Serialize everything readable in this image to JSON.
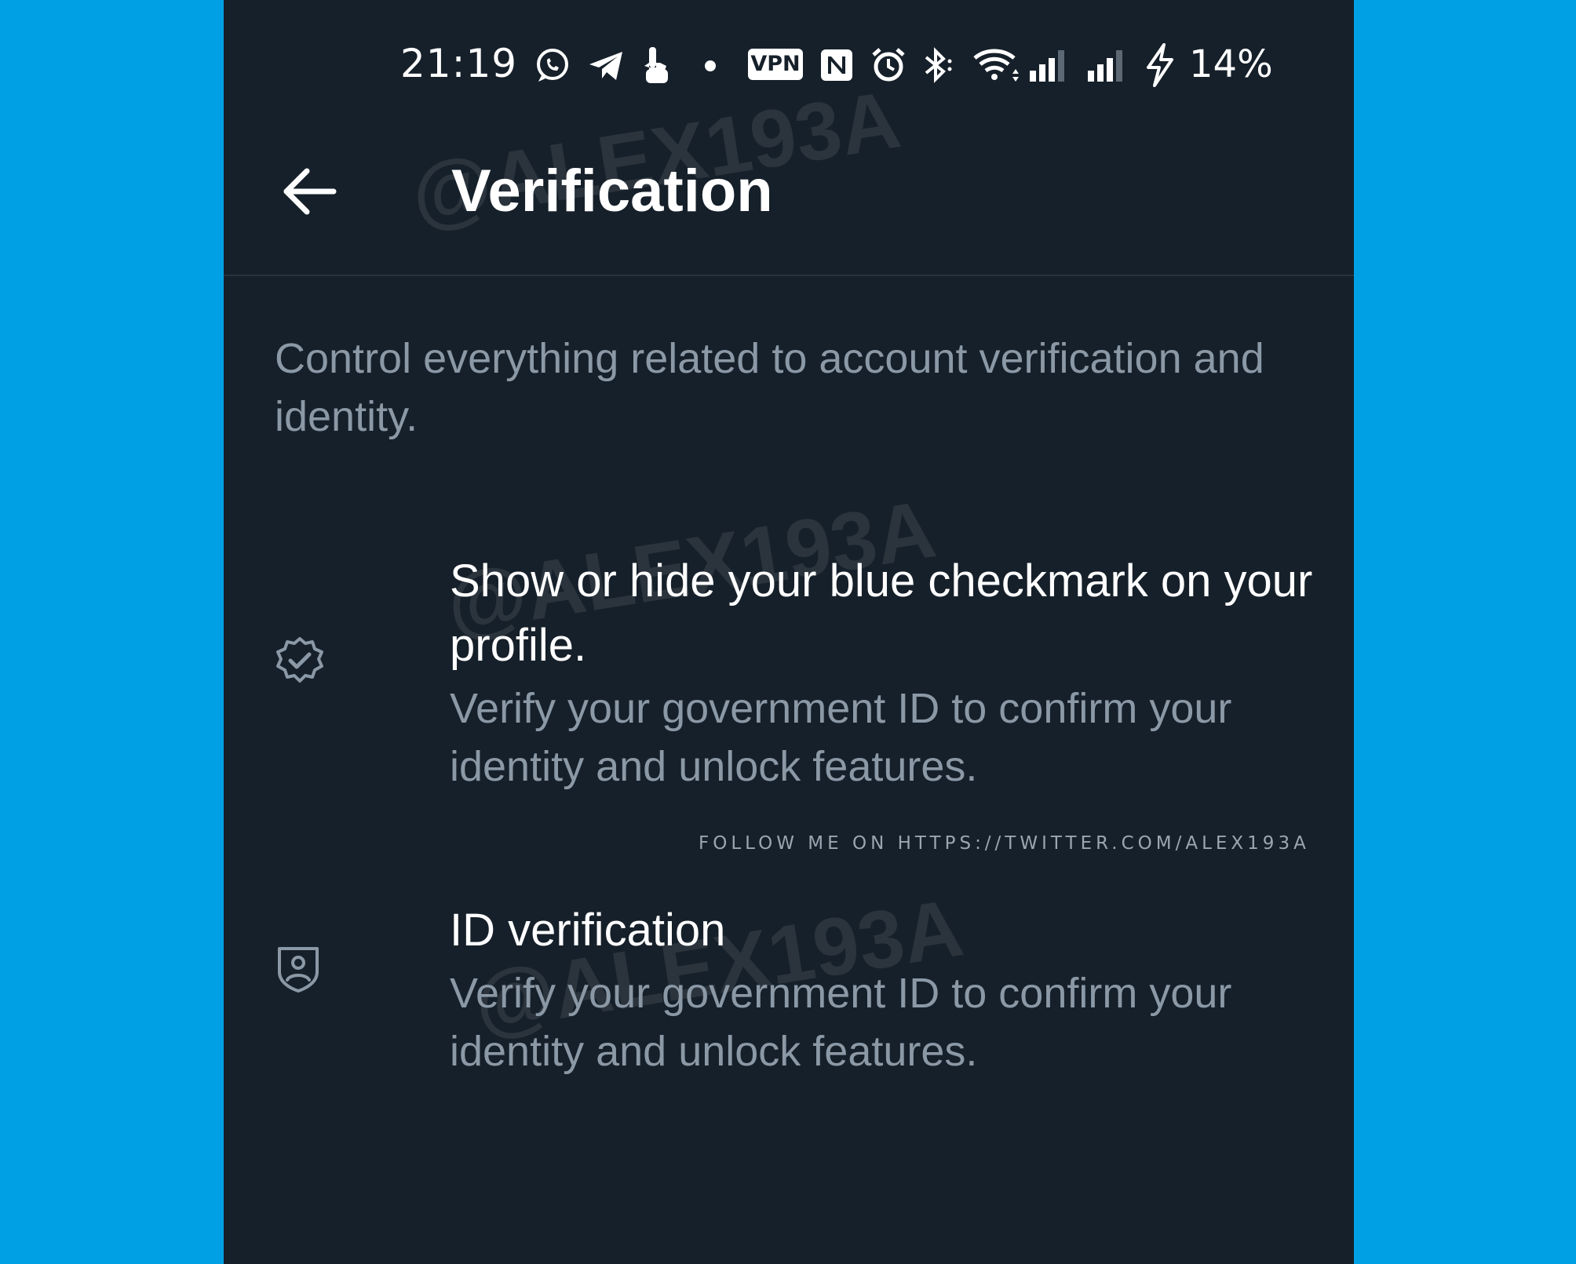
{
  "status_bar": {
    "time": "21:19",
    "vpn_label": "VPN",
    "battery": "14%",
    "icons": [
      "whatsapp-icon",
      "telegram-icon",
      "touch-icon",
      "dot-icon",
      "vpn-icon",
      "nfc-icon",
      "alarm-icon",
      "bluetooth-icon",
      "wifi-icon",
      "signal-icon",
      "signal-icon",
      "charging-icon"
    ]
  },
  "header": {
    "title": "Verification",
    "back_icon": "arrow-left-icon"
  },
  "description": "Control everything related to account verification and identity.",
  "items": [
    {
      "icon": "verified-badge-icon",
      "title": "Show or hide your blue checkmark on your profile.",
      "subtitle": "Verify your government ID to confirm your identity and unlock features."
    },
    {
      "icon": "shield-person-icon",
      "title": "ID verification",
      "subtitle": "Verify your government ID to confirm your identity and unlock features."
    }
  ],
  "watermark": "@ALEX193A",
  "follow_note": "FOLLOW ME ON HTTPS://TWITTER.COM/ALEX193A",
  "colors": {
    "outer_background": "#00a1e4",
    "screen_background": "#16202a",
    "primary_text": "#ffffff",
    "secondary_text": "#8b98a5"
  }
}
